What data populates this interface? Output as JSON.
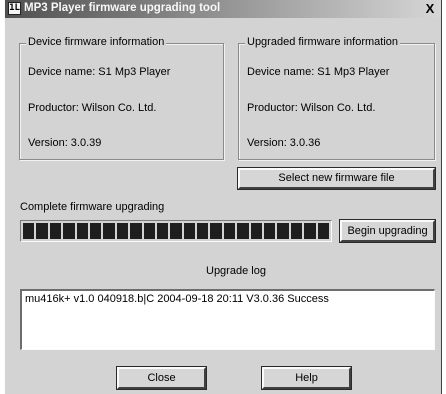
{
  "window": {
    "title": "MP3 Player firmware upgrading tool",
    "app_icon_glyph": "1L",
    "close_glyph": "X"
  },
  "device_info": {
    "legend": "Device firmware information",
    "name": "Device name: S1 Mp3 Player",
    "productor": "Productor: Wilson Co. Ltd.",
    "version": "Version: 3.0.39"
  },
  "upgraded_info": {
    "legend": "Upgraded firmware information",
    "name": "Device name: S1 Mp3 Player",
    "productor": "Productor: Wilson Co. Ltd.",
    "version": "Version: 3.0.36"
  },
  "buttons": {
    "select_file": "Select new firmware file",
    "begin": "Begin upgrading",
    "close": "Close",
    "help": "Help"
  },
  "progress": {
    "label": "Complete firmware upgrading",
    "percent": 100
  },
  "log": {
    "label": "Upgrade log",
    "entries": [
      "mu416k+ v1.0 040918.b|C  2004-09-18  20:11  V3.0.36  Success"
    ]
  },
  "colors": {
    "face": "#d3d3d3",
    "progress_block": "#1e1e1e",
    "log_bg": "#ffffff"
  }
}
